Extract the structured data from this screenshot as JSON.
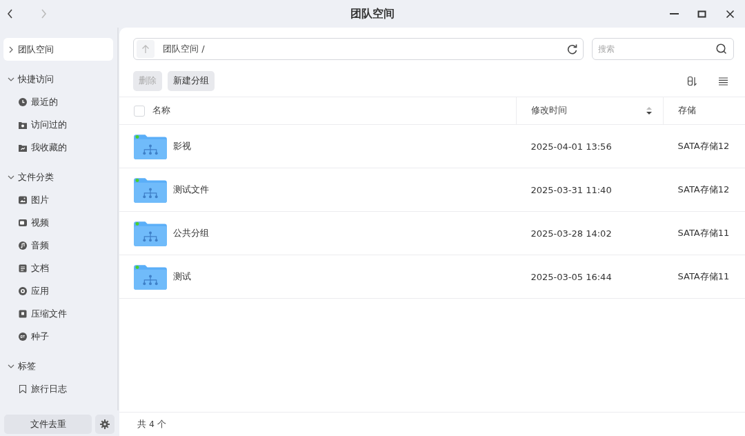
{
  "window": {
    "title": "团队空间",
    "back_enabled": true,
    "forward_enabled": false
  },
  "sidebar": {
    "top_item": {
      "label": "团队空间",
      "selected": true,
      "expanded": false
    },
    "sections": [
      {
        "title": "快捷访问",
        "expanded": true,
        "items": [
          {
            "label": "最近的",
            "kind": "clock"
          },
          {
            "label": "访问过的",
            "kind": "visited"
          },
          {
            "label": "我收藏的",
            "kind": "star"
          }
        ]
      },
      {
        "title": "文件分类",
        "expanded": true,
        "items": [
          {
            "label": "图片",
            "kind": "image"
          },
          {
            "label": "视频",
            "kind": "video"
          },
          {
            "label": "音频",
            "kind": "music"
          },
          {
            "label": "文档",
            "kind": "doc"
          },
          {
            "label": "应用",
            "kind": "app"
          },
          {
            "label": "压缩文件",
            "kind": "zip"
          },
          {
            "label": "种子",
            "kind": "bt"
          }
        ]
      },
      {
        "title": "标签",
        "expanded": true,
        "items": [
          {
            "label": "旅行日志",
            "kind": "bookmark"
          }
        ]
      }
    ],
    "footer_button": "文件去重"
  },
  "path_bar": {
    "path": "团队空间 /"
  },
  "search": {
    "placeholder": "搜索"
  },
  "toolbar": [
    {
      "label": "删除",
      "disabled": true
    },
    {
      "label": "新建分组",
      "disabled": false
    }
  ],
  "table": {
    "columns": [
      "名称",
      "修改时间",
      "存储"
    ],
    "all_checked": false,
    "rows": [
      {
        "name": "影视",
        "modified": "2025-04-01 13:56",
        "storage": "SATA存储12"
      },
      {
        "name": "测试文件",
        "modified": "2025-03-31 11:40",
        "storage": "SATA存储12"
      },
      {
        "name": "公共分组",
        "modified": "2025-03-28 14:02",
        "storage": "SATA存储11"
      },
      {
        "name": "测试",
        "modified": "2025-03-05 16:44",
        "storage": "SATA存储11"
      }
    ]
  },
  "status_bar": "共 4 个"
}
